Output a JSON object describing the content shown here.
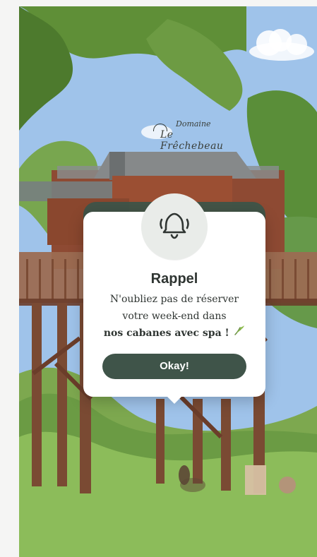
{
  "brand": {
    "line1": "Domaine",
    "line2": "Le Frêchebeau"
  },
  "popup": {
    "title": "Rappel",
    "line1": "N'oubliez pas de réserver",
    "line2": "votre week-end dans",
    "line3": "nos cabanes avec spa !",
    "button_label": "Okay!"
  },
  "colors": {
    "accent": "#3f5449",
    "popup_bg": "#ffffff",
    "bell_circle": "#e9ece9"
  },
  "icons": {
    "bell": "bell-icon",
    "leaf": "leaf-icon"
  }
}
